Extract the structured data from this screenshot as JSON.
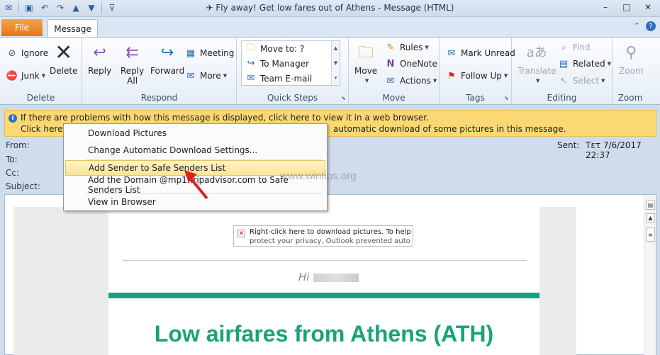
{
  "window": {
    "title": "✈ Fly away! Get low fares out of Athens  -  Message (HTML)",
    "controls": [
      "–",
      "□",
      "✕"
    ]
  },
  "tabs": {
    "file": "File",
    "message": "Message"
  },
  "ribbon": {
    "delete": {
      "label": "Delete",
      "ignore": "Ignore",
      "junk": "Junk",
      "delete_btn": "Delete"
    },
    "respond": {
      "label": "Respond",
      "reply": "Reply",
      "reply_all_1": "Reply",
      "reply_all_2": "All",
      "forward": "Forward",
      "meeting": "Meeting",
      "more": "More"
    },
    "quick_steps": {
      "label": "Quick Steps",
      "items": [
        "Move to: ?",
        "To Manager",
        "Team E-mail"
      ]
    },
    "move": {
      "label": "Move",
      "move_btn": "Move",
      "rules": "Rules",
      "onenote": "OneNote",
      "actions": "Actions"
    },
    "tags": {
      "label": "Tags",
      "mark_unread": "Mark Unread",
      "follow_up": "Follow Up"
    },
    "editing": {
      "label": "Editing",
      "translate": "Translate",
      "find": "Find",
      "related": "Related",
      "select": "Select"
    },
    "zoom": {
      "label": "Zoom",
      "zoom_btn": "Zoom"
    }
  },
  "infobar": {
    "line1": "If there are problems with how this message is displayed, click here to view it in a web browser.",
    "line2_start": "Click here t",
    "line2_end": "automatic download of some pictures in this message."
  },
  "header": {
    "from_label": "From:",
    "to_label": "To:",
    "cc_label": "Cc:",
    "subject_label": "Subject:",
    "sent_label": "Sent:",
    "sent_value": "Τετ 7/6/2017 22:37"
  },
  "context_menu": {
    "items": [
      "Download Pictures",
      "Change Automatic Download Settings...",
      "Add Sender to Safe Senders List",
      "Add the Domain @mp1.tripadvisor.com to Safe Senders List",
      "View in Browser"
    ]
  },
  "email": {
    "placeholder_line1": "Right-click here to download pictures.  To help",
    "placeholder_line2": "protect your privacy, Outlook prevented auto",
    "greeting": "Hi",
    "headline": "Low airfares from Athens (ATH)"
  },
  "watermark": "www.wintips.org",
  "colors": {
    "file_tab": "#e2761a",
    "infobar": "#fcd873",
    "headline": "#18a37a",
    "green_bar": "#16a085"
  }
}
